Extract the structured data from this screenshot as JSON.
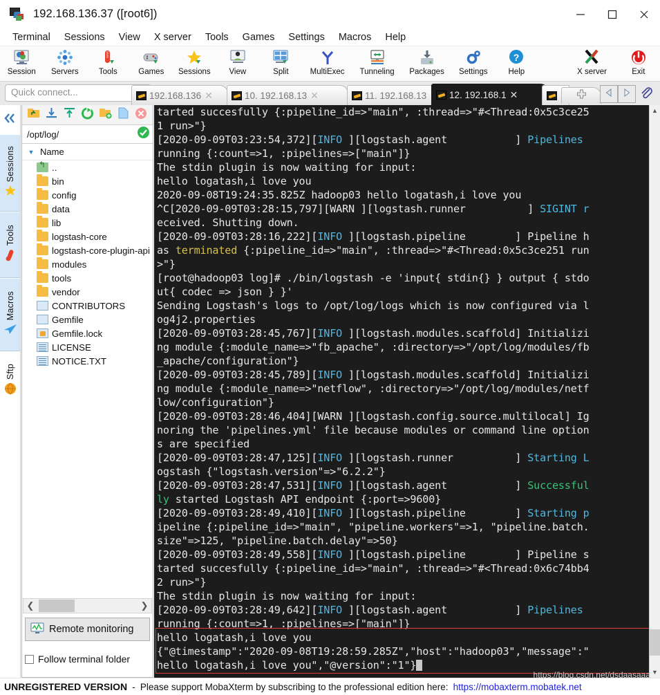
{
  "window": {
    "title": "192.168.136.37 ([root6])",
    "icon": "mobaxterm-icon",
    "controls": {
      "minimize": "minimize-icon",
      "maximize": "maximize-icon",
      "close": "close-icon"
    }
  },
  "menu": {
    "items": [
      "Terminal",
      "Sessions",
      "View",
      "X server",
      "Tools",
      "Games",
      "Settings",
      "Macros",
      "Help"
    ]
  },
  "toolbar": {
    "buttons": [
      {
        "label": "Session",
        "icon": "session-icon"
      },
      {
        "label": "Servers",
        "icon": "servers-icon"
      },
      {
        "label": "Tools",
        "icon": "tools-icon"
      },
      {
        "label": "Games",
        "icon": "games-icon"
      },
      {
        "label": "Sessions",
        "icon": "sessions-star-icon"
      },
      {
        "label": "View",
        "icon": "view-icon"
      },
      {
        "label": "Split",
        "icon": "split-icon"
      },
      {
        "label": "MultiExec",
        "icon": "multiexec-icon"
      },
      {
        "label": "Tunneling",
        "icon": "tunneling-icon"
      },
      {
        "label": "Packages",
        "icon": "packages-icon"
      },
      {
        "label": "Settings",
        "icon": "settings-gear-icon"
      },
      {
        "label": "Help",
        "icon": "help-icon"
      },
      {
        "label": "X server",
        "icon": "xserver-icon"
      },
      {
        "label": "Exit",
        "icon": "exit-power-icon"
      }
    ]
  },
  "quick_connect": {
    "placeholder": "Quick connect...",
    "value": ""
  },
  "tabs": {
    "items": [
      {
        "label": "192.168.136",
        "active": false
      },
      {
        "label": "10. 192.168.13",
        "active": false
      },
      {
        "label": "11. 192.168.13",
        "active": false
      },
      {
        "label": "12. 192.168.1",
        "active": true
      }
    ],
    "new_tab_icon": "new-tab-plus-icon",
    "nav_prev_icon": "nav-prev-icon",
    "nav_next_icon": "nav-next-icon",
    "attach_icon": "paperclip-icon"
  },
  "sidebar": {
    "collapse_icon": "collapse-chevrons-icon",
    "vtabs": [
      {
        "label": "Sessions",
        "icon": "star-icon"
      },
      {
        "label": "Tools",
        "icon": "thermometer-icon"
      },
      {
        "label": "Macros",
        "icon": "paper-plane-icon"
      },
      {
        "label": "Sftp",
        "icon": "globe-icon"
      }
    ]
  },
  "sftp": {
    "toolbar_icons": [
      "go-up-folder-icon",
      "download-icon",
      "upload-icon",
      "refresh-icon",
      "new-folder-icon",
      "new-file-icon",
      "delete-icon"
    ],
    "path": "/opt/log/",
    "path_ok_icon": "path-ok-check-icon",
    "column_header": "Name",
    "sort_icon": "sort-descending-icon",
    "files": [
      {
        "name": "..",
        "type": "up"
      },
      {
        "name": "bin",
        "type": "folder"
      },
      {
        "name": "config",
        "type": "folder"
      },
      {
        "name": "data",
        "type": "folder"
      },
      {
        "name": "lib",
        "type": "folder"
      },
      {
        "name": "logstash-core",
        "type": "folder"
      },
      {
        "name": "logstash-core-plugin-api",
        "type": "folder"
      },
      {
        "name": "modules",
        "type": "folder"
      },
      {
        "name": "tools",
        "type": "folder"
      },
      {
        "name": "vendor",
        "type": "folder"
      },
      {
        "name": "CONTRIBUTORS",
        "type": "file"
      },
      {
        "name": "Gemfile",
        "type": "file"
      },
      {
        "name": "Gemfile.lock",
        "type": "lock"
      },
      {
        "name": "LICENSE",
        "type": "doc"
      },
      {
        "name": "NOTICE.TXT",
        "type": "doc"
      }
    ],
    "hscroll": {
      "left_arrow": "scroll-left-arrow",
      "right_arrow": "scroll-right-arrow"
    },
    "remote_monitoring": {
      "label": "Remote monitoring",
      "icon": "monitor-graph-icon"
    },
    "follow_terminal_folder": {
      "label": "Follow terminal folder",
      "checked": false
    }
  },
  "terminal": {
    "lines": [
      [
        {
          "t": "tarted succesfully {:pipeline_id=>\"main\", :thread=>\"#<Thread:0x5c3ce25"
        }
      ],
      [
        {
          "t": "1 run>\"}"
        }
      ],
      [
        {
          "t": "[2020-09-09T03:23:54,372]["
        },
        {
          "t": "INFO",
          "c": "c-info"
        },
        {
          "t": " ][logstash.agent           ] "
        },
        {
          "t": "Pipelines",
          "c": "c-cyan"
        }
      ],
      [
        {
          "t": "running {:count=>1, :pipelines=>[\"main\"]}"
        }
      ],
      [
        {
          "t": "The stdin plugin is now waiting for input:"
        }
      ],
      [
        {
          "t": "hello logatash,i love you"
        }
      ],
      [
        {
          "t": "2020-09-08T19:24:35.825Z hadoop03 hello logatash,i love you"
        }
      ],
      [
        {
          "t": "^C[2020-09-09T03:28:15,797][WARN ][logstash.runner          ] "
        },
        {
          "t": "SIGINT r",
          "c": "c-cyan"
        }
      ],
      [
        {
          "t": "eceived. Shutting down."
        }
      ],
      [
        {
          "t": "[2020-09-09T03:28:16,222]["
        },
        {
          "t": "INFO",
          "c": "c-info"
        },
        {
          "t": " ][logstash.pipeline        ] Pipeline h"
        }
      ],
      [
        {
          "t": "as "
        },
        {
          "t": "terminated",
          "c": "c-yellow"
        },
        {
          "t": " {:pipeline_id=>\"main\", :thread=>\"#<Thread:0x5c3ce251 run"
        }
      ],
      [
        {
          "t": ">\"}"
        }
      ],
      [
        {
          "t": "[root@hadoop03 log]# ./bin/logstash -e 'input{ stdin{} } output { stdo"
        }
      ],
      [
        {
          "t": "ut{ codec => json } }'"
        }
      ],
      [
        {
          "t": "Sending Logstash's logs to /opt/log/logs which is now configured via l"
        }
      ],
      [
        {
          "t": "og4j2.properties"
        }
      ],
      [
        {
          "t": "[2020-09-09T03:28:45,767]["
        },
        {
          "t": "INFO",
          "c": "c-info"
        },
        {
          "t": " ][logstash.modules.scaffold] Initializi"
        }
      ],
      [
        {
          "t": "ng module {:module_name=>\"fb_apache\", :directory=>\"/opt/log/modules/fb"
        }
      ],
      [
        {
          "t": "_apache/configuration\"}"
        }
      ],
      [
        {
          "t": "[2020-09-09T03:28:45,789]["
        },
        {
          "t": "INFO",
          "c": "c-info"
        },
        {
          "t": " ][logstash.modules.scaffold] Initializi"
        }
      ],
      [
        {
          "t": "ng module {:module_name=>\"netflow\", :directory=>\"/opt/log/modules/netf"
        }
      ],
      [
        {
          "t": "low/configuration\"}"
        }
      ],
      [
        {
          "t": "[2020-09-09T03:28:46,404][WARN ][logstash.config.source.multilocal] Ig"
        }
      ],
      [
        {
          "t": "noring the 'pipelines.yml' file because modules or command line option"
        }
      ],
      [
        {
          "t": "s are specified"
        }
      ],
      [
        {
          "t": "[2020-09-09T03:28:47,125]["
        },
        {
          "t": "INFO",
          "c": "c-info"
        },
        {
          "t": " ][logstash.runner          ] "
        },
        {
          "t": "Starting L",
          "c": "c-cyan"
        }
      ],
      [
        {
          "t": "ogstash {\"logstash.version\"=>\"6.2.2\"}"
        }
      ],
      [
        {
          "t": "[2020-09-09T03:28:47,531]["
        },
        {
          "t": "INFO",
          "c": "c-info"
        },
        {
          "t": " ][logstash.agent           ] "
        },
        {
          "t": "Successful",
          "c": "c-green"
        }
      ],
      [
        {
          "t": "ly",
          "c": "c-green"
        },
        {
          "t": " started Logstash API endpoint {:port=>9600}"
        }
      ],
      [
        {
          "t": "[2020-09-09T03:28:49,410]["
        },
        {
          "t": "INFO",
          "c": "c-info"
        },
        {
          "t": " ][logstash.pipeline        ] "
        },
        {
          "t": "Starting p",
          "c": "c-cyan"
        }
      ],
      [
        {
          "t": "ipeline {:pipeline_id=>\"main\", \"pipeline.workers\"=>1, \"pipeline.batch."
        }
      ],
      [
        {
          "t": "size\"=>125, \"pipeline.batch.delay\"=>50}"
        }
      ],
      [
        {
          "t": "[2020-09-09T03:28:49,558]["
        },
        {
          "t": "INFO",
          "c": "c-info"
        },
        {
          "t": " ][logstash.pipeline        ] Pipeline s"
        }
      ],
      [
        {
          "t": "tarted succesfully {:pipeline_id=>\"main\", :thread=>\"#<Thread:0x6c74bb4"
        }
      ],
      [
        {
          "t": "2 run>\"}"
        }
      ],
      [
        {
          "t": "The stdin plugin is now waiting for input:"
        }
      ],
      [
        {
          "t": "[2020-09-09T03:28:49,642]["
        },
        {
          "t": "INFO",
          "c": "c-info"
        },
        {
          "t": " ][logstash.agent           ] "
        },
        {
          "t": "Pipelines",
          "c": "c-cyan"
        }
      ],
      [
        {
          "t": "running {:count=>1, :pipelines=>[\"main\"]}"
        }
      ],
      [
        {
          "t": "hello logatash,i love you"
        }
      ],
      [
        {
          "t": "{\"@timestamp\":\"2020-09-08T19:28:59.285Z\",\"host\":\"hadoop03\",\"message\":\""
        }
      ],
      [
        {
          "t": "hello logatash,i love you\",\"@version\":\"1\"}",
          "cursor": true
        }
      ]
    ],
    "highlight_color": "#e03c3c"
  },
  "status_bar": {
    "unregistered": "UNREGISTERED VERSION",
    "dash": "-",
    "message": "Please support MobaXterm by subscribing to the professional edition here:",
    "link": "https://mobaxterm.mobatek.net"
  },
  "watermark": "https://blog.csdn.net/dsdaasaaa"
}
